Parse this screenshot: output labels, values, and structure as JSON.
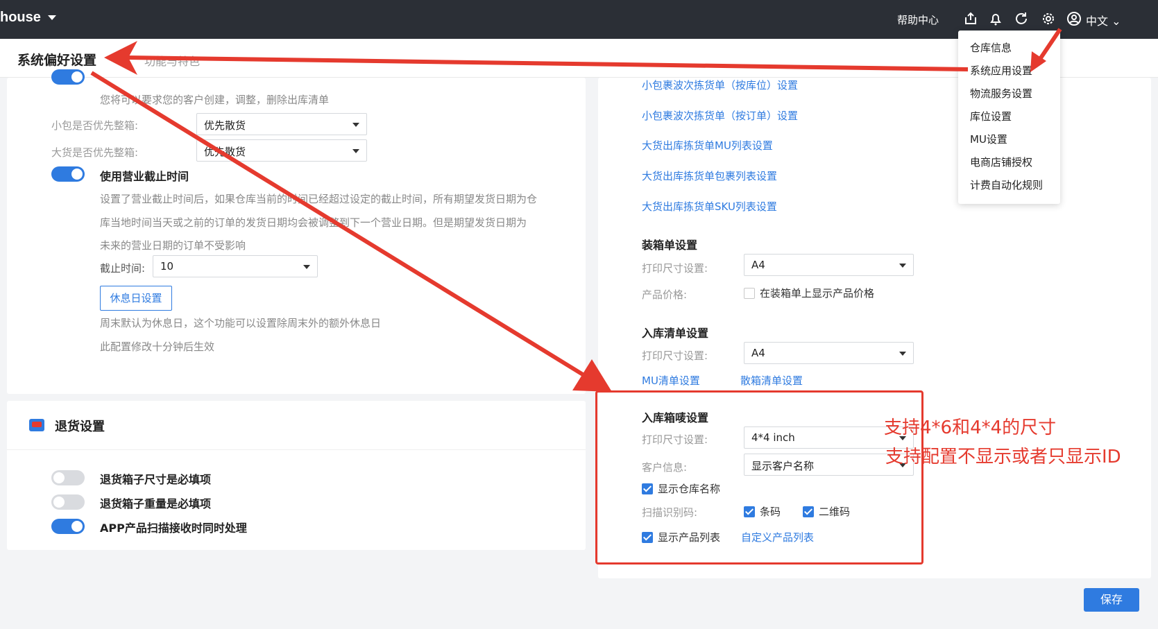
{
  "topbar": {
    "brand": "house",
    "help": "帮助中心",
    "lang": "中文"
  },
  "header": {
    "title": "系统偏好设置",
    "tab2": "功能与特色"
  },
  "dropdown": {
    "items": [
      "仓库信息",
      "系统应用设置",
      "物流服务设置",
      "库位设置",
      "MU设置",
      "电商店铺授权",
      "计费自动化规则"
    ]
  },
  "left": {
    "desc_top": "您将可以要求您的客户创建，调整，删除出库清单",
    "small_parcel_label": "小包是否优先整箱:",
    "small_parcel_value": "优先散货",
    "bulk_label": "大货是否优先整箱:",
    "bulk_value": "优先散货",
    "cutoff_toggle_label": "使用营业截止时间",
    "cutoff_desc_1": "设置了营业截止时间后，如果仓库当前的时间已经超过设定的截止时间，所有期望发货日期为仓",
    "cutoff_desc_2": "库当地时间当天或之前的订单的发货日期均会被调整到下一个营业日期。但是期望发货日期为",
    "cutoff_desc_3": "未来的营业日期的订单不受影响",
    "cutoff_time_label": "截止时间:",
    "cutoff_time_value": "10",
    "holiday_button": "休息日设置",
    "holiday_desc": "周末默认为休息日，这个功能可以设置除周末外的额外休息日",
    "effect_note": "此配置修改十分钟后生效"
  },
  "returns": {
    "title": "退货设置",
    "items": [
      "退货箱子尺寸是必填项",
      "退货箱子重量是必填项",
      "APP产品扫描接收时同时处理"
    ],
    "states": [
      false,
      false,
      true
    ]
  },
  "right": {
    "links": [
      "小包裹波次拣货单（按库位）设置",
      "小包裹波次拣货单（按订单）设置",
      "大货出库拣货单MU列表设置",
      "大货出库拣货单包裹列表设置",
      "大货出库拣货单SKU列表设置"
    ],
    "packing_title": "装箱单设置",
    "print_size_label": "打印尺寸设置:",
    "packing_size": "A4",
    "price_label": "产品价格:",
    "price_checkbox": "在装箱单上显示产品价格",
    "inbound_title": "入库清单设置",
    "inbound_size": "A4",
    "mu_list_link": "MU清单设置",
    "bulk_list_link": "散箱清单设置",
    "mark_title": "入库箱唛设置",
    "mark_size": "4*4 inch",
    "customer_label": "客户信息:",
    "customer_value": "显示客户名称",
    "show_warehouse": "显示仓库名称",
    "scan_label": "扫描识别码:",
    "barcode": "条码",
    "qrcode": "二维码",
    "show_product_list": "显示产品列表",
    "custom_product_list": "自定义产品列表"
  },
  "annotations": {
    "size_note": "支持4*6和4*4的尺寸",
    "id_note": "支持配置不显示或者只显示ID"
  },
  "footer": {
    "save": "保存"
  },
  "colors": {
    "accent": "#2f7be0",
    "annotation": "#e53a2e",
    "topbar": "#2b2f36"
  }
}
